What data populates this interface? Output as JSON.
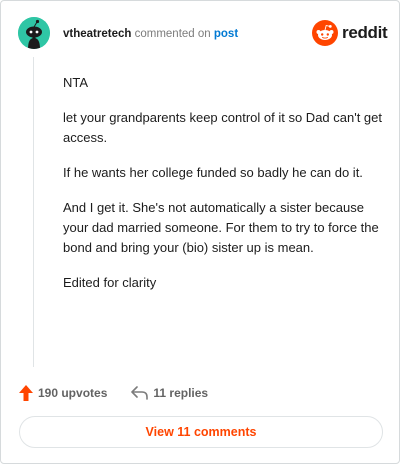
{
  "header": {
    "username": "vtheatretech",
    "action_text": "commented on",
    "post_link": "post"
  },
  "brand": {
    "wordmark": "reddit",
    "accent_color": "#ff4500",
    "avatar_color": "#2fc6a5"
  },
  "comment": {
    "paragraphs": [
      "NTA",
      "let your grandparents keep control of it so Dad can't get access.",
      "If he wants her college funded so badly he can do it.",
      "And I get it. She's not automatically a sister because your dad married someone. For them to try to force the bond and bring your (bio) sister up is mean.",
      "Edited for clarity"
    ]
  },
  "actions": {
    "upvotes": "190 upvotes",
    "replies": "11 replies"
  },
  "view_button": "View 11 comments",
  "icons": {
    "avatar": "snoo-avatar-icon",
    "logo": "reddit-logo-icon",
    "upvote": "upvote-arrow-icon",
    "reply": "reply-arrow-icon"
  }
}
